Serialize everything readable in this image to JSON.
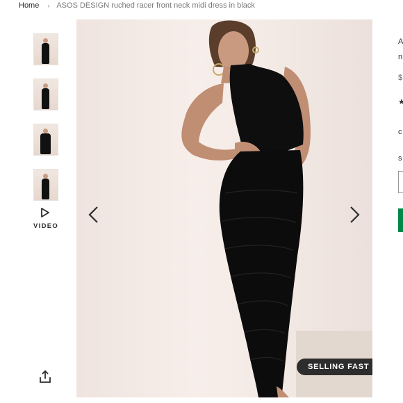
{
  "breadcrumb": {
    "home": "Home",
    "separator": "›",
    "current": "ASOS DESIGN ruched racer front neck midi dress in black"
  },
  "gallery": {
    "thumbnails": [
      "thumb-1",
      "thumb-2",
      "thumb-3",
      "thumb-4"
    ],
    "video_label": "VIDEO",
    "badge": "SELLING FAST"
  },
  "right_column_partial": {
    "title_fragment": "A",
    "title_line2_fragment": "n",
    "price_fragment": "$",
    "rating_fragment": "★",
    "colour_fragment": "c",
    "size_fragment": "s"
  },
  "colors": {
    "add_to_bag": "#018849",
    "badge_bg": "#2d2d2d",
    "text": "#2d2d2d"
  },
  "icons": [
    "chevron-right-icon",
    "play-icon",
    "share-icon",
    "arrow-left-icon",
    "arrow-right-icon"
  ]
}
